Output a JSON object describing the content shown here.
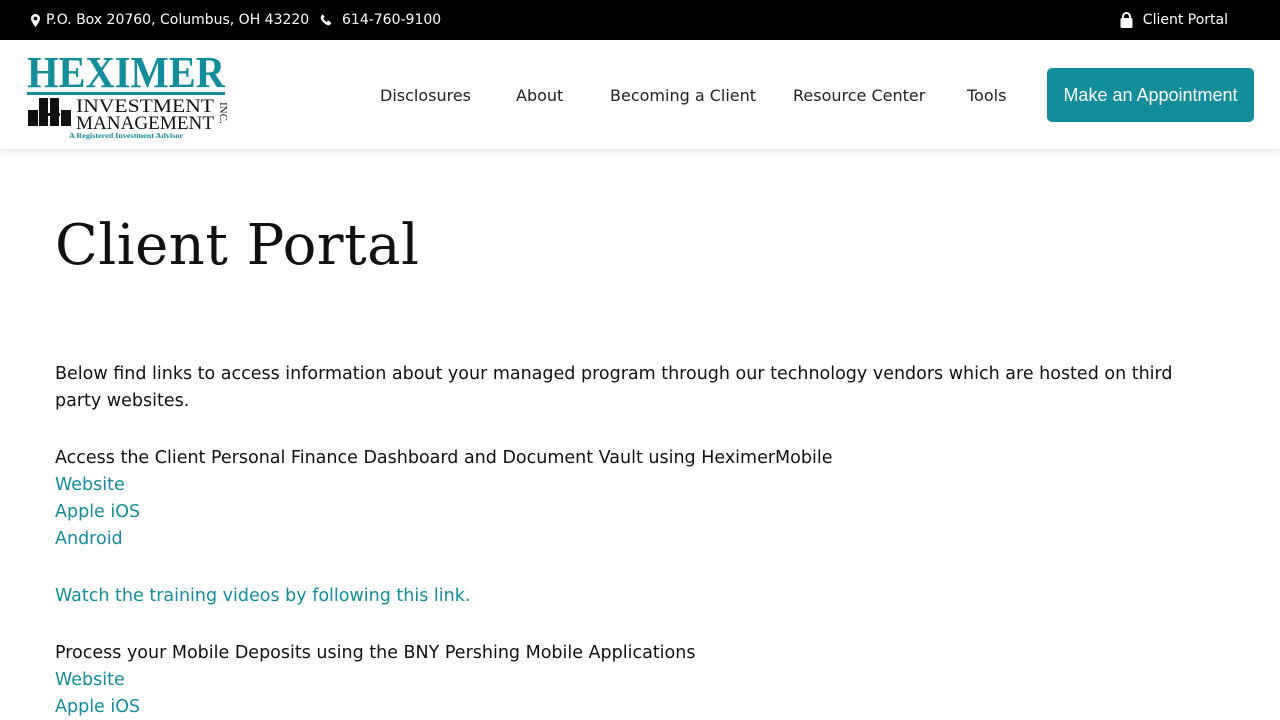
{
  "topbar": {
    "address": "P.O. Box 20760, Columbus, OH 43220",
    "phone": "614-760-9100",
    "client_portal": "Client Portal"
  },
  "logo": {
    "line1": "HEXIMER",
    "line2": "INVESTMENT",
    "line3": "MANAGEMENT",
    "inc": "INC.",
    "tagline": "A Registered Investment Advisor",
    "brand_color": "#128d9b"
  },
  "nav": {
    "items": [
      "Disclosures",
      "About",
      "Becoming a Client",
      "Resource Center",
      "Tools"
    ],
    "cta": "Make an Appointment"
  },
  "main": {
    "title": "Client Portal",
    "intro": "Below find links to access information about your managed program through our technology vendors which are hosted on third party websites.",
    "section1": {
      "heading": "Access the Client Personal Finance Dashboard and Document Vault using HeximerMobile",
      "links": [
        "Website",
        "Apple iOS",
        "Android"
      ]
    },
    "training_link": "Watch the training videos by following this link.",
    "section2": {
      "heading": "Process your Mobile Deposits using the BNY Pershing Mobile Applications",
      "links": [
        "Website",
        "Apple iOS"
      ]
    }
  },
  "colors": {
    "accent": "#128d9b",
    "topbar_bg": "#000000"
  }
}
